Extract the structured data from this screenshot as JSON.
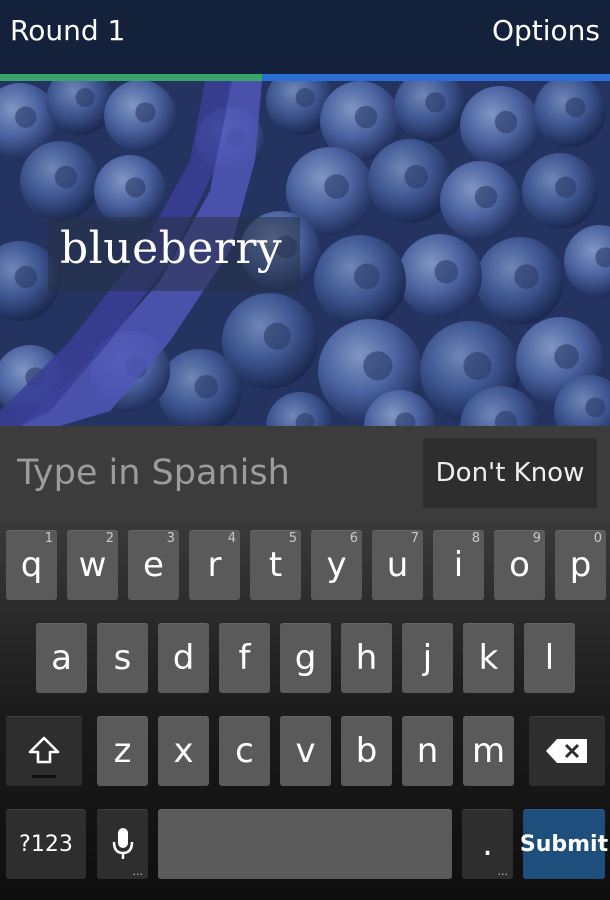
{
  "header": {
    "title": "Round 1",
    "options_label": "Options",
    "progress_fraction": 0.43,
    "colors": {
      "bar": "#14213a",
      "progress_done": "#39a56a",
      "progress_remaining": "#2b6fd6"
    }
  },
  "prompt": {
    "word": "blueberry",
    "image_icon": "blueberries-photo"
  },
  "answer": {
    "placeholder": "Type in Spanish",
    "value": "",
    "dont_know_label": "Don't Know"
  },
  "keyboard": {
    "row1": [
      {
        "key": "q",
        "hint": "1"
      },
      {
        "key": "w",
        "hint": "2"
      },
      {
        "key": "e",
        "hint": "3"
      },
      {
        "key": "r",
        "hint": "4"
      },
      {
        "key": "t",
        "hint": "5"
      },
      {
        "key": "y",
        "hint": "6"
      },
      {
        "key": "u",
        "hint": "7"
      },
      {
        "key": "i",
        "hint": "8"
      },
      {
        "key": "o",
        "hint": "9"
      },
      {
        "key": "p",
        "hint": "0"
      }
    ],
    "row2": [
      "a",
      "s",
      "d",
      "f",
      "g",
      "h",
      "j",
      "k",
      "l"
    ],
    "row3": [
      "z",
      "x",
      "c",
      "v",
      "b",
      "n",
      "m"
    ],
    "symbols_label": "?123",
    "period_label": ".",
    "submit_label": "Submit",
    "shift_icon": "shift-icon",
    "backspace_icon": "backspace-icon",
    "mic_icon": "microphone-icon",
    "submit_color": "#1d4e7c"
  }
}
